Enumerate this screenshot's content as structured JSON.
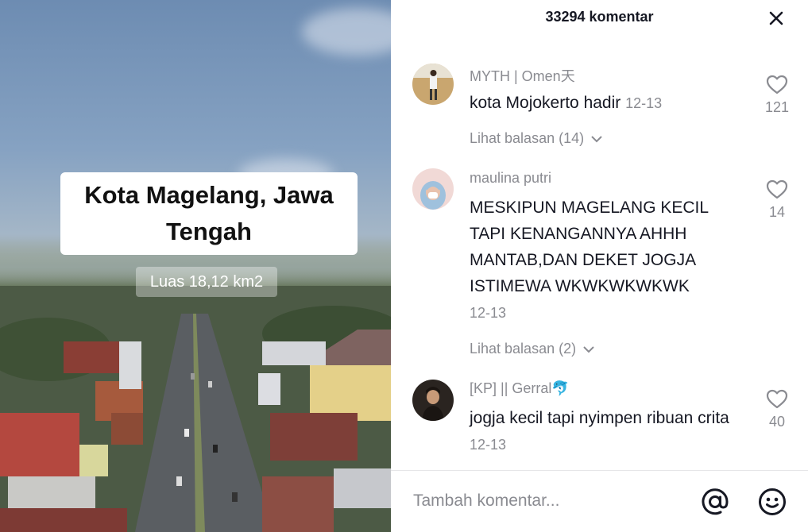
{
  "video": {
    "title": "Kota Magelang, Jawa Tengah",
    "area_label": "Luas 18,12 km2"
  },
  "comments_panel": {
    "count_label": "33294 komentar",
    "close_icon": "close-icon",
    "comments": [
      {
        "username": "MYTH | Omen天",
        "text": "kota Mojokerto hadir",
        "date": "12-13",
        "likes": "121",
        "replies_label": "Lihat balasan (14)"
      },
      {
        "username": "maulina putri",
        "text": "MESKIPUN MAGELANG KECIL TAPI KENANGANNYA AHHH MANTAB,DAN DEKET JOGJA ISTIMEWA WKWKWKWKWK",
        "date": "12-13",
        "likes": "14",
        "replies_label": "Lihat balasan (2)"
      },
      {
        "username": "[KP] || Gerral🐬",
        "text": "jogja kecil tapi nyimpen ribuan crita",
        "date": "12-13",
        "likes": "40"
      }
    ],
    "footer": {
      "placeholder": "Tambah komentar...",
      "at_icon": "at-mention-icon",
      "emoji_icon": "emoji-icon"
    }
  },
  "colors": {
    "panel_bg": "#ffffff",
    "primary_text": "#161823",
    "secondary_text": "#8a8b91"
  }
}
